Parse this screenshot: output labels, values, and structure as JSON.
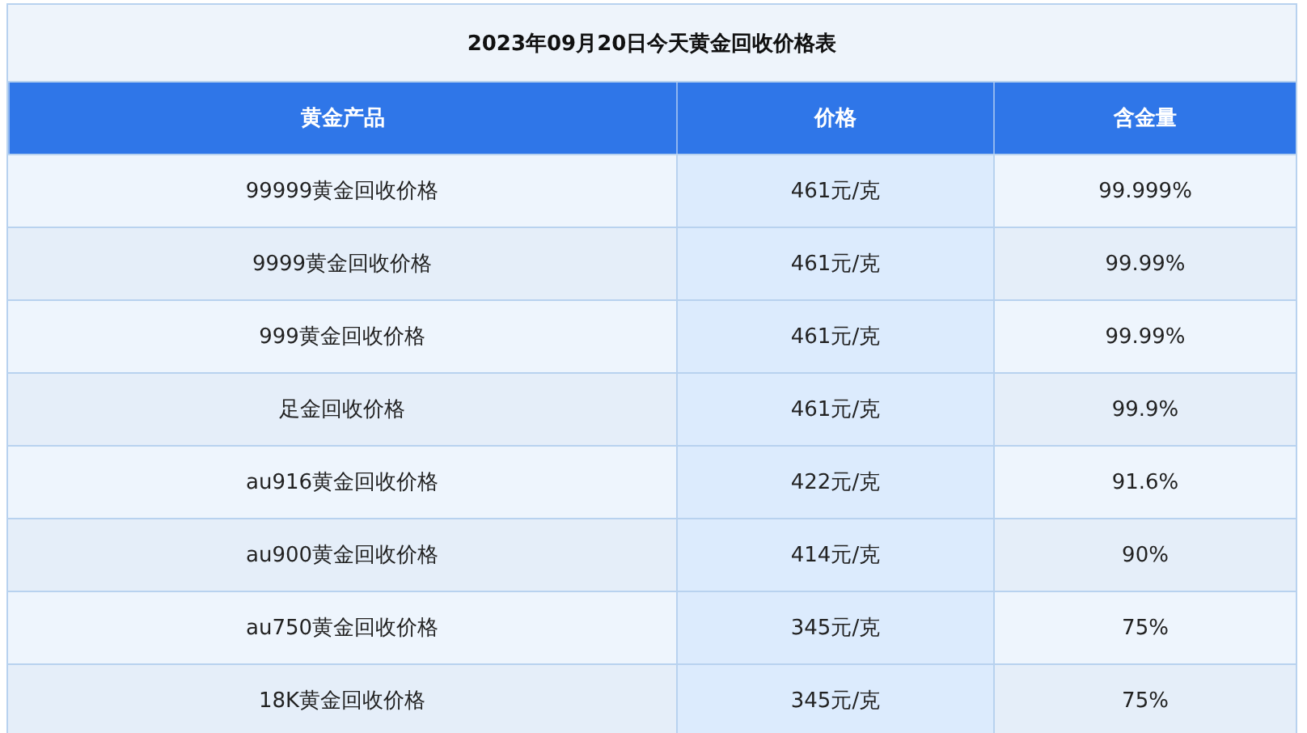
{
  "table": {
    "title": "2023年09月20日今天黄金回收价格表",
    "columns": [
      "黄金产品",
      "价格",
      "含金量"
    ],
    "rows": [
      [
        "99999黄金回收价格",
        "461元/克",
        "99.999%"
      ],
      [
        "9999黄金回收价格",
        "461元/克",
        "99.99%"
      ],
      [
        "999黄金回收价格",
        "461元/克",
        "99.99%"
      ],
      [
        "足金回收价格",
        "461元/克",
        "99.9%"
      ],
      [
        "au916黄金回收价格",
        "422元/克",
        "91.6%"
      ],
      [
        "au900黄金回收价格",
        "414元/克",
        "90%"
      ],
      [
        "au750黄金回收价格",
        "345元/克",
        "75%"
      ],
      [
        "18K黄金回收价格",
        "345元/克",
        "75%"
      ]
    ]
  }
}
